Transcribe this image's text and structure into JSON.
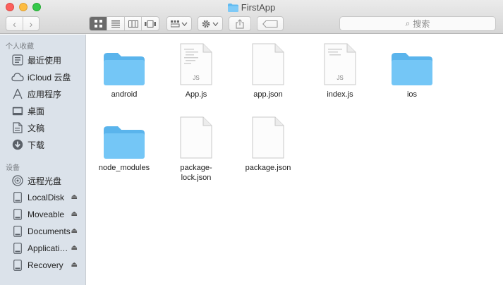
{
  "window": {
    "title": "FirstApp"
  },
  "toolbar": {
    "back_glyph": "‹",
    "forward_glyph": "›",
    "search_placeholder": "搜索",
    "search_glyph": "⌕",
    "colors": {
      "active_view": "#6b6b6b"
    }
  },
  "sidebar": {
    "favorites_header": "个人收藏",
    "devices_header": "设备",
    "favorites": [
      {
        "label": "最近使用",
        "icon": "recents-icon"
      },
      {
        "label": "iCloud 云盘",
        "icon": "cloud-icon"
      },
      {
        "label": "应用程序",
        "icon": "applications-icon"
      },
      {
        "label": "桌面",
        "icon": "desktop-icon"
      },
      {
        "label": "文稿",
        "icon": "documents-icon"
      },
      {
        "label": "下载",
        "icon": "downloads-icon"
      }
    ],
    "devices": [
      {
        "label": "远程光盘",
        "icon": "disc-icon"
      },
      {
        "label": "LocalDisk",
        "icon": "disk-icon"
      },
      {
        "label": "Moveable",
        "icon": "disk-icon"
      },
      {
        "label": "Documents",
        "icon": "disk-icon"
      },
      {
        "label": "Applications",
        "icon": "disk-icon"
      },
      {
        "label": "Recovery",
        "icon": "disk-icon"
      }
    ],
    "eject_glyph": "⏏"
  },
  "files": [
    {
      "name": "android",
      "kind": "folder"
    },
    {
      "name": "App.js",
      "kind": "js"
    },
    {
      "name": "app.json",
      "kind": "doc"
    },
    {
      "name": "index.js",
      "kind": "js"
    },
    {
      "name": "ios",
      "kind": "folder"
    },
    {
      "name": "node_modules",
      "kind": "folder"
    },
    {
      "name": "package-lock.json",
      "kind": "doc"
    },
    {
      "name": "package.json",
      "kind": "doc"
    }
  ],
  "js_badge": "JS"
}
